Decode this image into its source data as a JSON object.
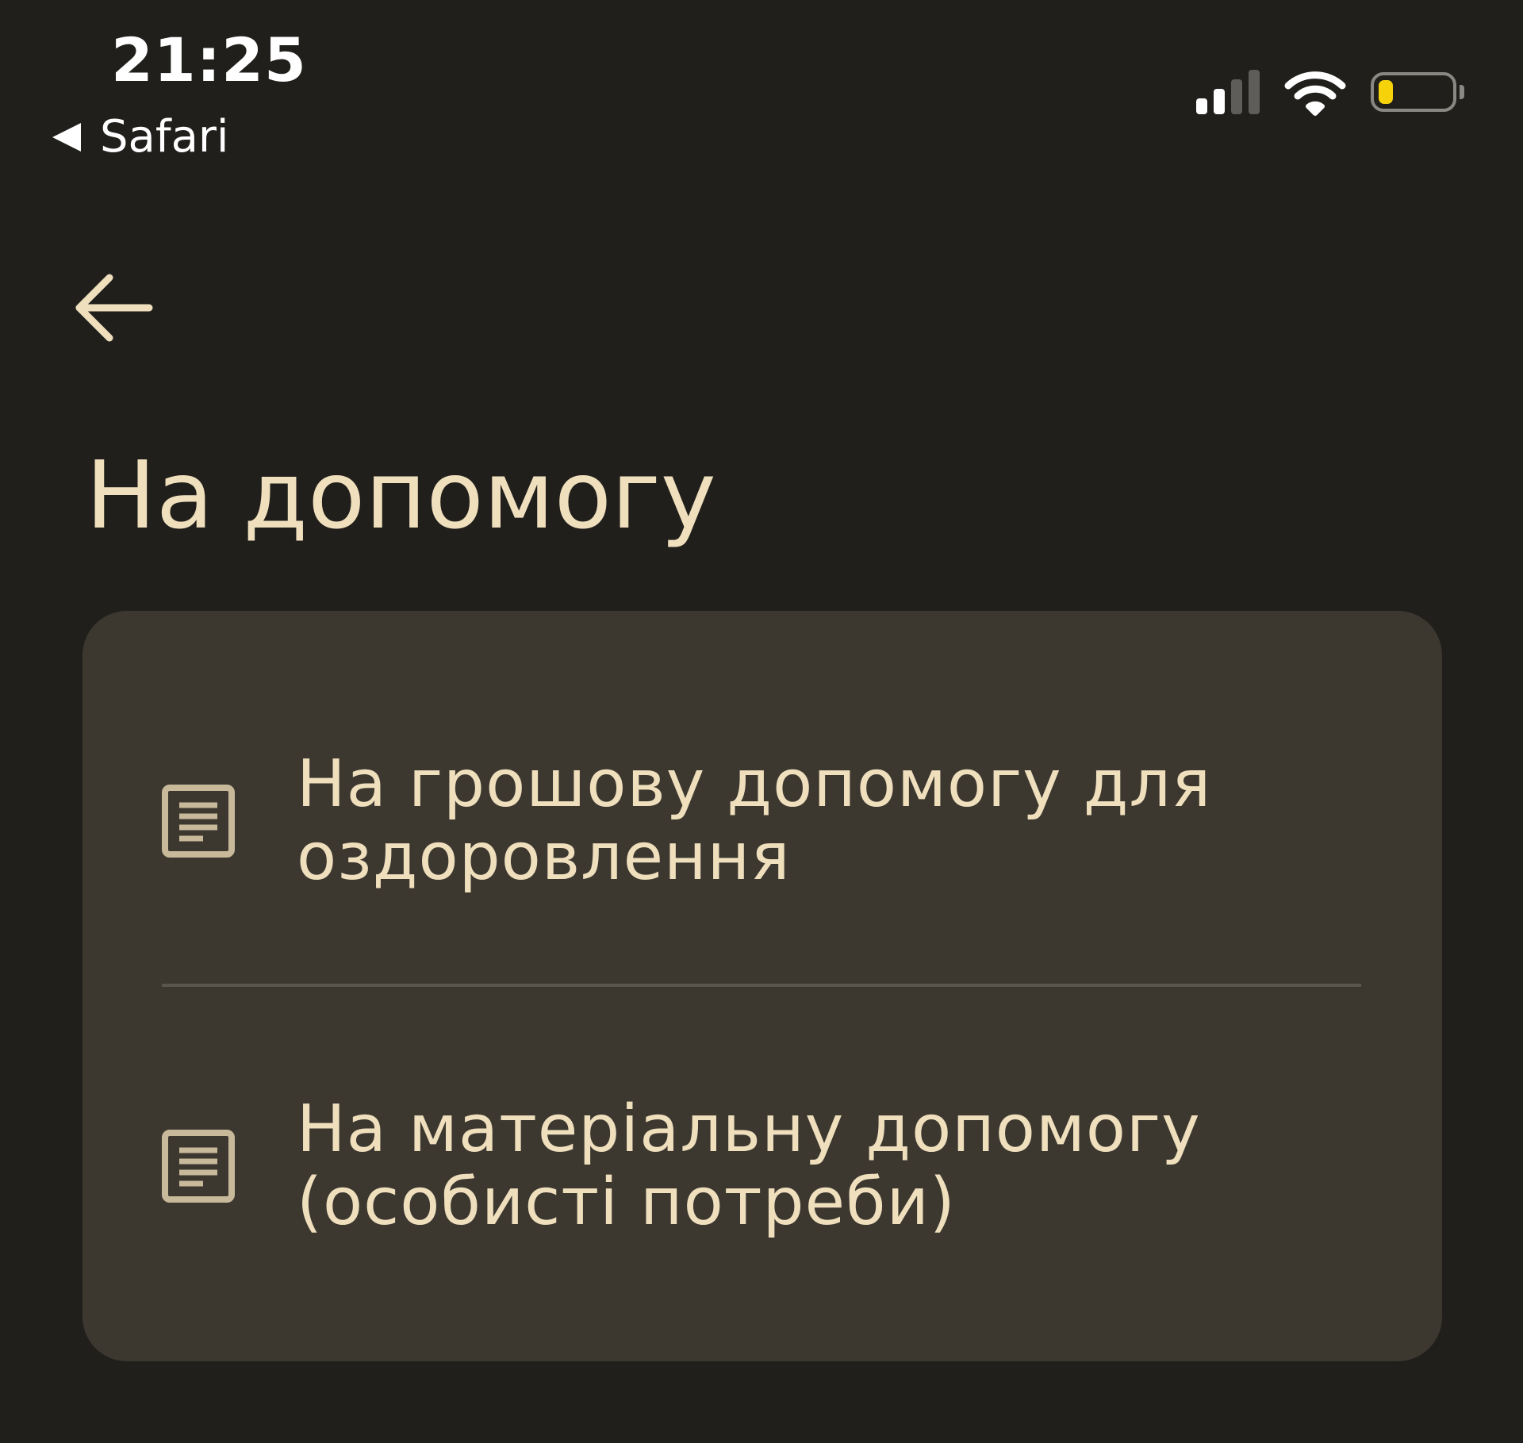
{
  "status_bar": {
    "time": "21:25",
    "back_app_label": "Safari",
    "signal_icon": "cellular-signal-icon",
    "wifi_icon": "wifi-icon",
    "battery_icon": "battery-icon",
    "battery_level": 0.2
  },
  "navigation": {
    "back_icon": "arrow-left-icon"
  },
  "page": {
    "title": "На допомогу"
  },
  "menu": {
    "items": [
      {
        "icon": "document-icon",
        "label": "На грошову допомогу для оздоровлення"
      },
      {
        "icon": "document-icon",
        "label": "На матеріальну допомогу (особисті потреби)"
      }
    ]
  },
  "colors": {
    "background": "#211f1c",
    "card": "#3c3830",
    "accent_text": "#efdfbd",
    "battery_fill": "#f5d20a",
    "divider": "#5b564d"
  }
}
